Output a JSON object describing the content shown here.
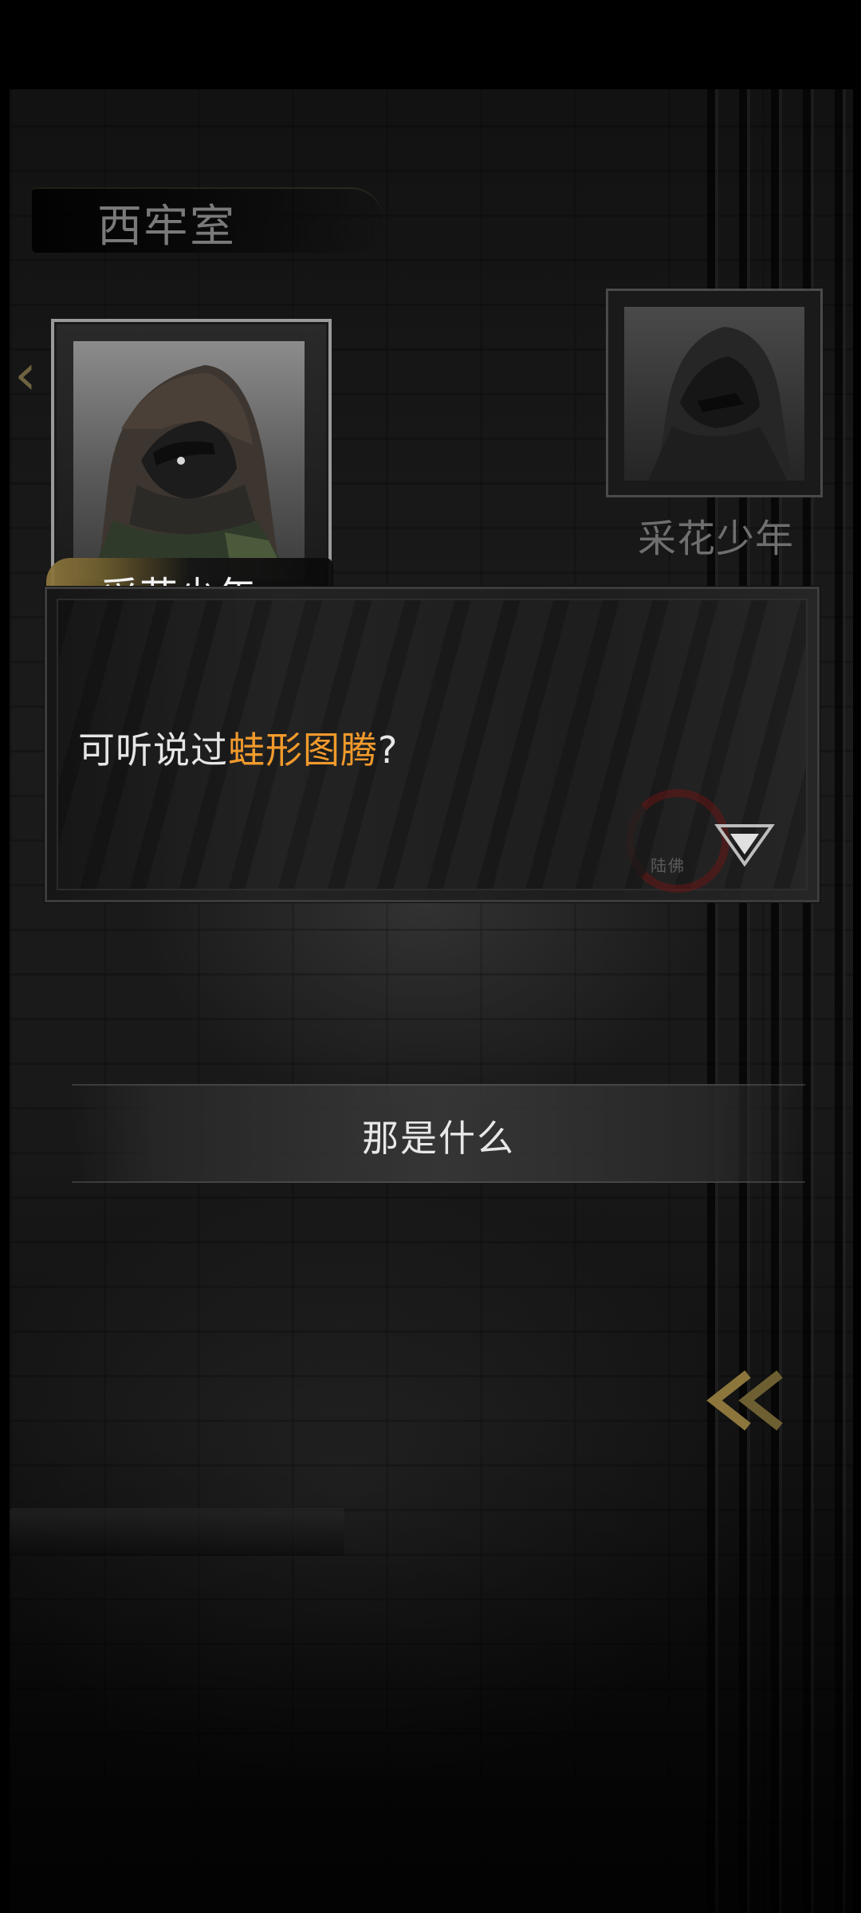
{
  "location": {
    "name": "西牢室"
  },
  "speaker": {
    "name": "采花少年",
    "portrait_icon": "hooded-boy-portrait"
  },
  "other_character": {
    "name": "采花少年",
    "portrait_icon": "hooded-boy-portrait"
  },
  "dialogue": {
    "prefix": "可听说过",
    "highlight": "蛙形图腾",
    "suffix": "?",
    "highlight_color": "#f29a2c",
    "seal_text": "陆佛"
  },
  "choices": [
    {
      "label": "那是什么"
    }
  ],
  "icons": {
    "continue": "triangle-down-icon",
    "side": "double-chevron-left-icon",
    "left_edge": "chevron-left-icon"
  },
  "colors": {
    "accent_gold": "#8c763c",
    "text_primary": "#e6e6e6",
    "text_dim": "#6f6f6f"
  }
}
